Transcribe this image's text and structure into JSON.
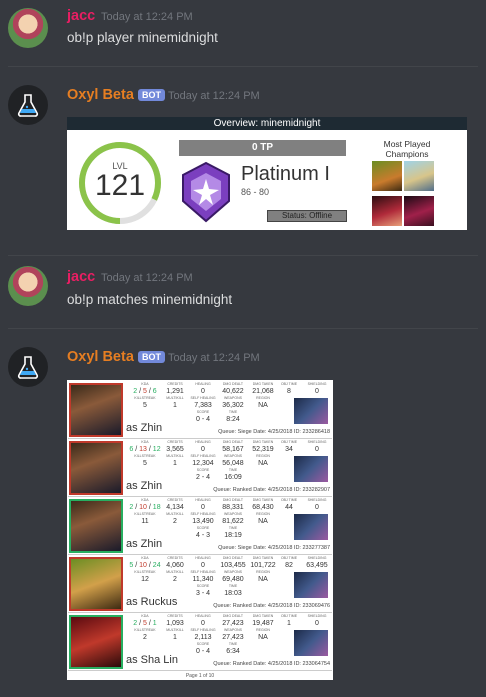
{
  "messages": [
    {
      "author": "jacc",
      "timestamp": "Today at 12:24 PM",
      "text": "ob!p player minemidnight"
    },
    {
      "author": "Oxyl Beta",
      "badge": "BOT",
      "timestamp": "Today at 12:24 PM"
    },
    {
      "author": "jacc",
      "timestamp": "Today at 12:24 PM",
      "text": "ob!p matches minemidnight"
    },
    {
      "author": "Oxyl Beta",
      "badge": "BOT",
      "timestamp": "Today at 12:24 PM"
    }
  ],
  "overview": {
    "title": "Overview: minemidnight",
    "level_label": "LVL",
    "level": "121",
    "level_progress": 0.82,
    "tp": "0 TP",
    "rank": "Platinum I",
    "rank_tp": "86 - 80",
    "status": "Status: Offline",
    "most_played_label": "Most Played Champions",
    "ring_color": "#8bc34a",
    "rank_color": "#7b3fbf"
  },
  "matches": {
    "headers": {
      "kda": "KDA",
      "credits": "CREDITS",
      "healing": "HEALING",
      "dmg_dealt": "DMG DEALT",
      "dmg_taken": "DMG TAKEN",
      "obj_time": "OBJ TIME",
      "shielding": "SHIELDING",
      "killstreak": "KILLSTREAK",
      "multikill": "MULTIKILL",
      "self_healing": "SELF HEALING",
      "weapon": "WEAPONS",
      "region": "REGION",
      "score": "SCORE",
      "time": "TIME"
    },
    "rows": [
      {
        "result": "loss",
        "champion": "as Zhin",
        "k": "2",
        "d": "5",
        "a": "6",
        "credits": "1,291",
        "healing": "0",
        "dmg_dealt": "40,622",
        "dmg_taken": "21,068",
        "obj_time": "8",
        "shielding": "0",
        "killstreak": "5",
        "multikill": "1",
        "self_healing": "7,383",
        "weapon": "36,302",
        "region": "NA",
        "score": "0 - 4",
        "time": "8:24",
        "queue": "Queue: Siege  Date: 4/25/2018  ID: 233286418"
      },
      {
        "result": "loss",
        "champion": "as Zhin",
        "k": "6",
        "d": "13",
        "a": "12",
        "credits": "3,565",
        "healing": "0",
        "dmg_dealt": "58,167",
        "dmg_taken": "52,319",
        "obj_time": "34",
        "shielding": "0",
        "killstreak": "5",
        "multikill": "1",
        "self_healing": "12,304",
        "weapon": "56,048",
        "region": "NA",
        "score": "2 - 4",
        "time": "16:09",
        "queue": "Queue: Ranked  Date: 4/25/2018  ID: 233282907"
      },
      {
        "result": "win",
        "champion": "as Zhin",
        "k": "2",
        "d": "10",
        "a": "18",
        "credits": "4,134",
        "healing": "0",
        "dmg_dealt": "88,331",
        "dmg_taken": "68,430",
        "obj_time": "44",
        "shielding": "0",
        "killstreak": "11",
        "multikill": "2",
        "self_healing": "13,490",
        "weapon": "81,622",
        "region": "NA",
        "score": "4 - 3",
        "time": "18:19",
        "queue": "Queue: Siege  Date: 4/25/2018  ID: 233277387"
      },
      {
        "result": "loss",
        "champion": "as Ruckus",
        "k": "5",
        "d": "10",
        "a": "24",
        "credits": "4,060",
        "healing": "0",
        "dmg_dealt": "103,455",
        "dmg_taken": "101,722",
        "obj_time": "82",
        "shielding": "63,495",
        "killstreak": "12",
        "multikill": "2",
        "self_healing": "11,340",
        "weapon": "69,480",
        "region": "NA",
        "score": "3 - 4",
        "time": "18:03",
        "queue": "Queue: Ranked  Date: 4/25/2018  ID: 233069476"
      },
      {
        "result": "win",
        "champion": "as Sha Lin",
        "k": "2",
        "d": "5",
        "a": "1",
        "credits": "1,093",
        "healing": "0",
        "dmg_dealt": "27,423",
        "dmg_taken": "19,487",
        "obj_time": "1",
        "shielding": "0",
        "killstreak": "2",
        "multikill": "1",
        "self_healing": "2,113",
        "weapon": "27,423",
        "region": "NA",
        "score": "0 - 4",
        "time": "6:34",
        "queue": "Queue: Ranked  Date: 4/25/2018  ID: 233064754"
      }
    ],
    "pager": "Page 1 of 10"
  }
}
